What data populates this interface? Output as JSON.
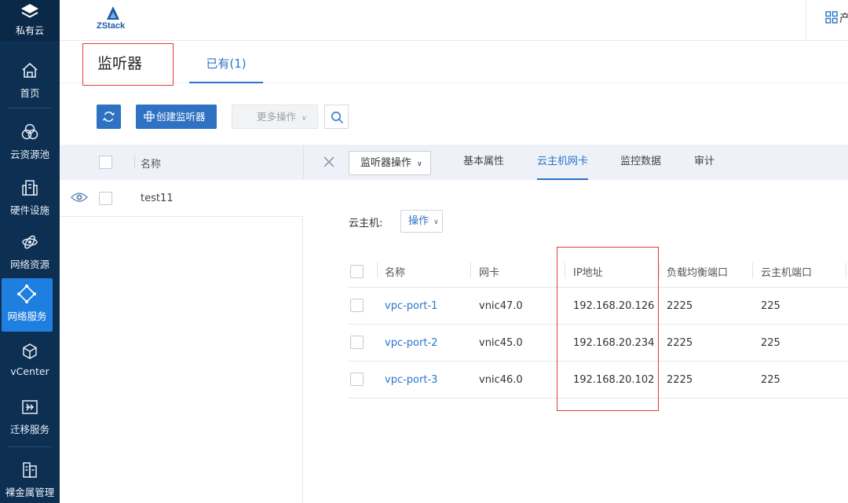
{
  "nav": {
    "brand_label": "私有云",
    "items": [
      {
        "label": "首页",
        "icon": "home-icon"
      },
      {
        "label": "云资源池",
        "icon": "resource-pool-icon"
      },
      {
        "label": "硬件设施",
        "icon": "hardware-icon"
      },
      {
        "label": "网络资源",
        "icon": "network-resource-icon"
      },
      {
        "label": "网络服务",
        "icon": "network-service-icon"
      },
      {
        "label": "vCenter",
        "icon": "vcenter-icon"
      },
      {
        "label": "迁移服务",
        "icon": "migration-icon"
      },
      {
        "label": "裸金属管理",
        "icon": "baremetal-icon"
      }
    ],
    "active_color": "#1f7fe0"
  },
  "header": {
    "logo_text": "ZStack",
    "right_text": "产"
  },
  "page": {
    "title": "监听器",
    "tab_existing": "已有(1)"
  },
  "toolbar": {
    "create_label": "创建监听器",
    "more_label": "更多操作"
  },
  "list": {
    "header_name": "名称",
    "rows": [
      {
        "name": "test11"
      }
    ]
  },
  "detail": {
    "op_button": "监听器操作",
    "tabs": [
      "基本属性",
      "云主机网卡",
      "监控数据",
      "审计"
    ],
    "active_tab": "云主机网卡",
    "vm_label": "云主机:",
    "vm_op_button": "操作"
  },
  "nic_table": {
    "columns": [
      "名称",
      "网卡",
      "IP地址",
      "负载均衡端口",
      "云主机端口"
    ],
    "rows": [
      {
        "name": "vpc-port-1",
        "nic": "vnic47.0",
        "ip": "192.168.20.126",
        "lb_port": "2225",
        "vm_port": "225"
      },
      {
        "name": "vpc-port-2",
        "nic": "vnic45.0",
        "ip": "192.168.20.234",
        "lb_port": "2225",
        "vm_port": "225"
      },
      {
        "name": "vpc-port-3",
        "nic": "vnic46.0",
        "ip": "192.168.20.102",
        "lb_port": "2225",
        "vm_port": "225"
      }
    ]
  },
  "colors": {
    "accent": "#2b74c9",
    "highlight": "#e03c3c",
    "nav_bg": "#0c2f52"
  }
}
